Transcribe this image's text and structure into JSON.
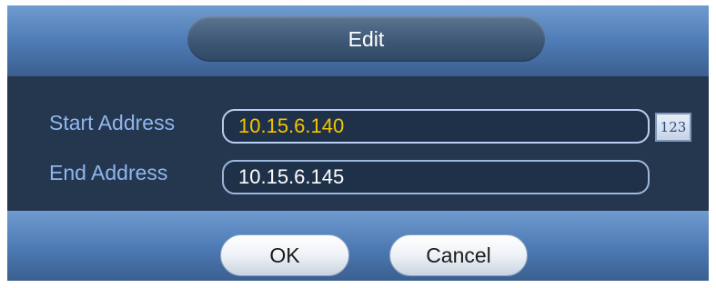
{
  "dialog": {
    "title": "Edit"
  },
  "start": {
    "label": "Start Address",
    "value": "10.15.6.140",
    "value_color": "#f5c400"
  },
  "end": {
    "label": "End Address",
    "value": "10.15.6.145",
    "value_color": "#ffffff"
  },
  "keyboard_button": {
    "label": "123"
  },
  "buttons": {
    "ok": "OK",
    "cancel": "Cancel"
  }
}
